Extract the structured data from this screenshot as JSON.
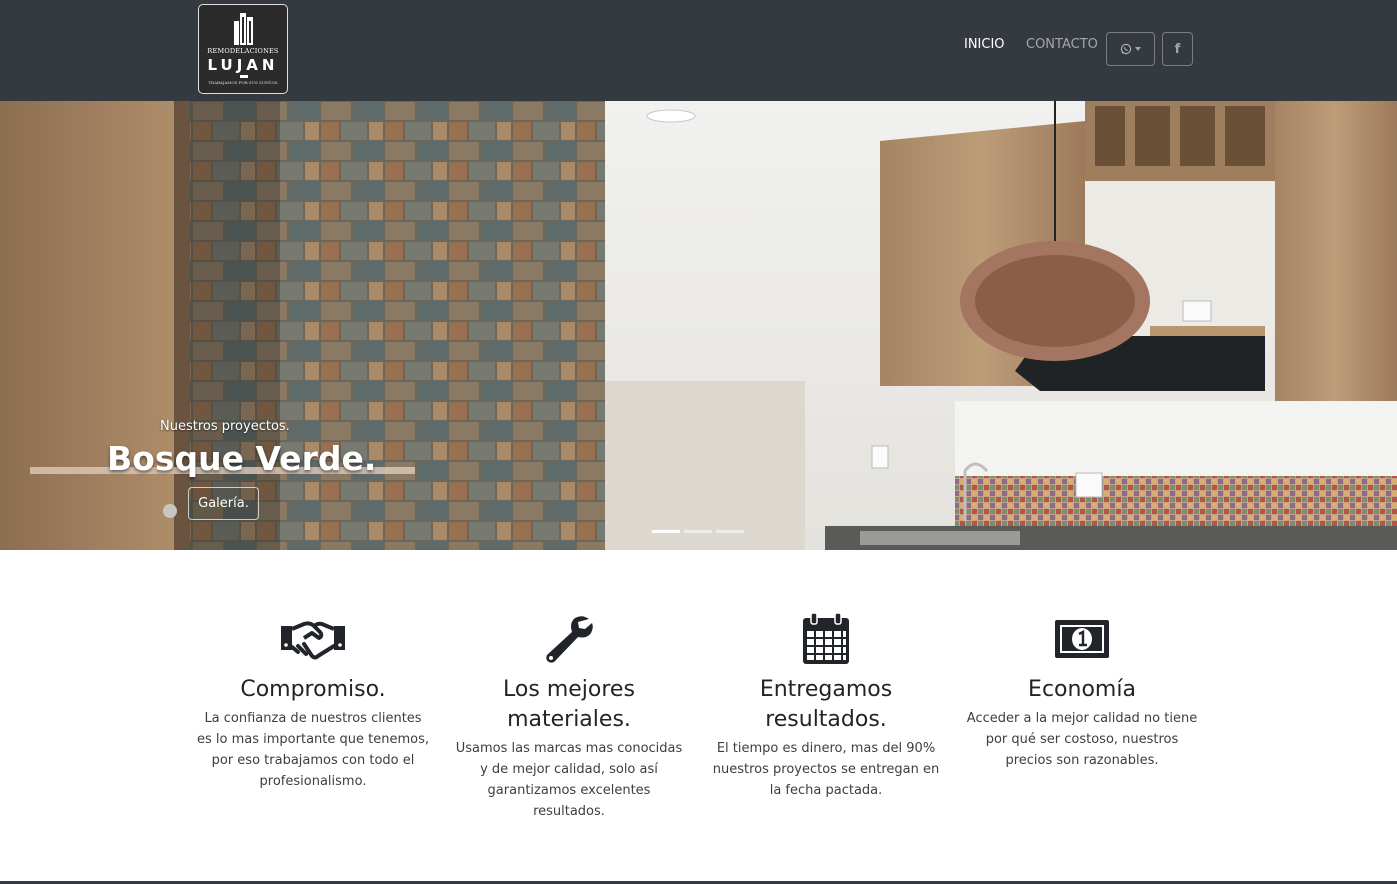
{
  "logo": {
    "line1": "REMODELACIONES",
    "line2": "LUJAN",
    "line3": "TRABAJAMOS POR SUS SUEÑOS",
    "icon": "building-icon"
  },
  "nav": {
    "items": [
      {
        "label": "INICIO",
        "active": true
      },
      {
        "label": "CONTACTO",
        "active": false
      }
    ],
    "whatsapp_icon": "whatsapp-icon",
    "facebook_label": "f"
  },
  "hero": {
    "subtitle": "Nuestros proyectos.",
    "title": "Bosque Verde.",
    "button": "Galería.",
    "slides": 3,
    "active_slide": 0
  },
  "features": [
    {
      "icon": "handshake-icon",
      "title": "Compromiso.",
      "text": "La confianza de nuestros clientes es lo mas importante que tenemos, por eso trabajamos con todo el profesionalismo."
    },
    {
      "icon": "wrench-icon",
      "title": "Los mejores materiales.",
      "text": "Usamos las marcas mas conocidas y de mejor calidad, solo así garantizamos excelentes resultados."
    },
    {
      "icon": "calendar-icon",
      "title": "Entregamos resultados.",
      "text": "El tiempo es dinero, mas del 90% nuestros proyectos se entregan en la fecha pactada."
    },
    {
      "icon": "money-bill-icon",
      "title": "Economía",
      "text": "Acceder a la mejor calidad no tiene por qué ser costoso, nuestros precios son razonables."
    }
  ],
  "colors": {
    "navbar": "#343a40",
    "text": "#212529"
  }
}
